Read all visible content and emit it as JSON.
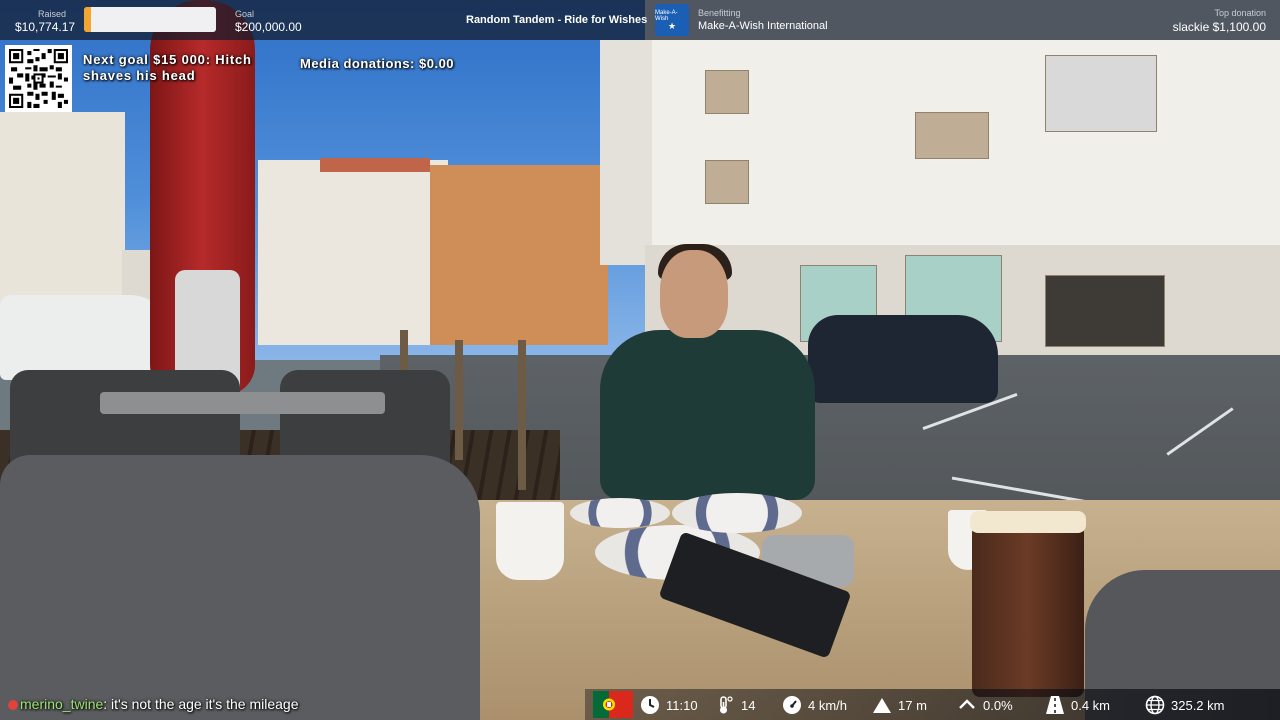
{
  "topbar": {
    "raised_label": "Raised",
    "raised_value": "$10,774.17",
    "goal_label": "Goal",
    "goal_value": "$200,000.00",
    "progress_fraction": 0.054,
    "stream_title": "Random Tandem - Ride for Wishes",
    "charity_logo_text": "Make-A-Wish",
    "benefitting_label": "Benefitting",
    "charity_name": "Make-A-Wish International",
    "top_donation_label": "Top donation",
    "top_donation_value": "slackie $1,100.00"
  },
  "overlay": {
    "next_goal": "Next goal $15 000: Hitch shaves his head",
    "media_donations": "Media donations: $0.00"
  },
  "chat": {
    "username": "merino_twine",
    "message": "it's not the age it's the mileage"
  },
  "stats": {
    "flag": "portugal-flag",
    "time": "11:10",
    "temperature": "14",
    "speed": "4 km/h",
    "altitude": "17 m",
    "incline": "0.0%",
    "distance_today": "0.4 km",
    "distance_total": "325.2 km"
  },
  "colors": {
    "progress_fill": "#f3a531",
    "charity_blue": "#1a5fb4",
    "chat_username": "#9ee070"
  }
}
